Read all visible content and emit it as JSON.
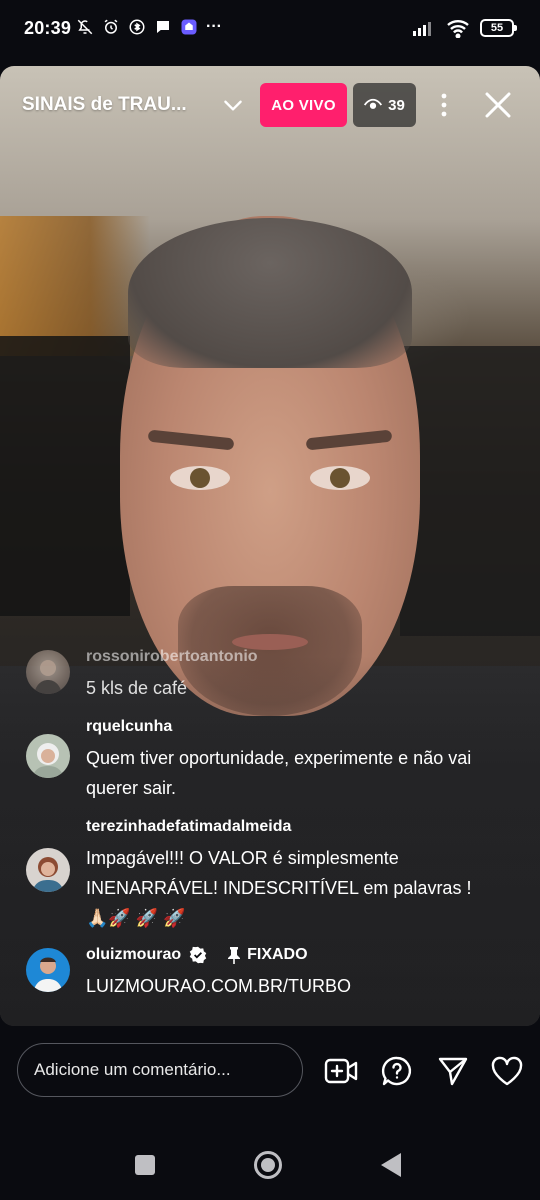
{
  "status_bar": {
    "time": "20:39",
    "battery": "55",
    "overflow": "···"
  },
  "live": {
    "title": "SINAIS de TRAU...",
    "badge": "AO VIVO",
    "viewers": "39"
  },
  "comments": [
    {
      "user": "rossonirobertoantonio",
      "text": "5 kls de café"
    },
    {
      "user": "rquelcunha",
      "text": "Quem tiver oportunidade, experimente e não vai querer sair."
    },
    {
      "user": "terezinhadefatimadalmeida",
      "text": "Impagável!!! O VALOR é simplesmente INENARRÁVEL! INDESCRITÍVEL em palavras !🙏🏻🚀 🚀 🚀"
    },
    {
      "user": "oluizmourao",
      "text": "LUIZMOURAO.COM.BR/TURBO",
      "pinned_label": "FIXADO"
    }
  ],
  "composer": {
    "placeholder": "Adicione um comentário..."
  },
  "colors": {
    "live_badge": "#ff1f6d",
    "background": "#0a0b10"
  },
  "icons": [
    "mute-icon",
    "alarm-icon",
    "bluetooth-icon",
    "chat-icon",
    "app-icon",
    "signal-icon",
    "wifi-icon",
    "eye-icon",
    "chevron-down-icon",
    "more-vertical-icon",
    "close-icon",
    "verified-icon",
    "pin-icon",
    "add-video-icon",
    "question-icon",
    "send-icon",
    "heart-icon",
    "square-icon",
    "home-circle-icon",
    "back-triangle-icon"
  ]
}
